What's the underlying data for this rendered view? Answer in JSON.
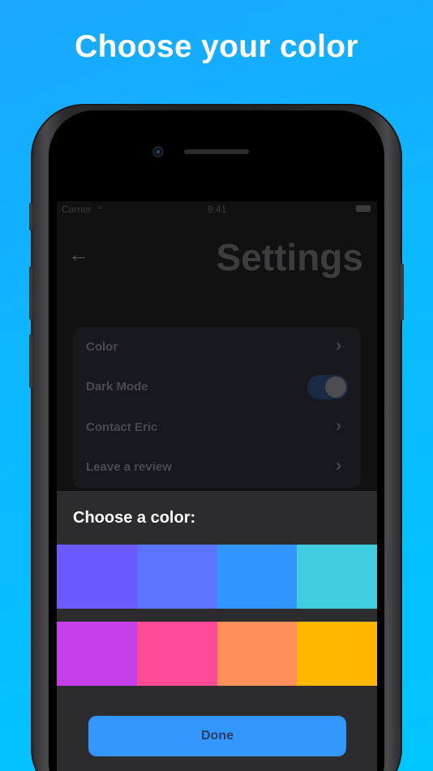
{
  "headline": "Choose your color",
  "status_bar": {
    "carrier": "Carrier",
    "time": "9:41"
  },
  "header": {
    "back_icon": "arrow-left-icon",
    "title": "Settings"
  },
  "settings": {
    "items": [
      {
        "label": "Color",
        "control": "chevron"
      },
      {
        "label": "Dark Mode",
        "control": "toggle",
        "value": true
      },
      {
        "label": "Contact Eric",
        "control": "chevron"
      },
      {
        "label": "Leave a review",
        "control": "chevron"
      }
    ]
  },
  "color_sheet": {
    "title": "Choose a color:",
    "swatches": [
      [
        "#6A5AFF",
        "#5B74FF",
        "#3196FF",
        "#3FCDE0"
      ],
      [
        "#C441EA",
        "#FF4B96",
        "#FF8F5B",
        "#FFB800"
      ]
    ],
    "done_label": "Done"
  },
  "colors": {
    "background": "#0CB8FF",
    "screen": "#111112",
    "sheet": "#2C2C2E",
    "accent": "#3397FF"
  }
}
